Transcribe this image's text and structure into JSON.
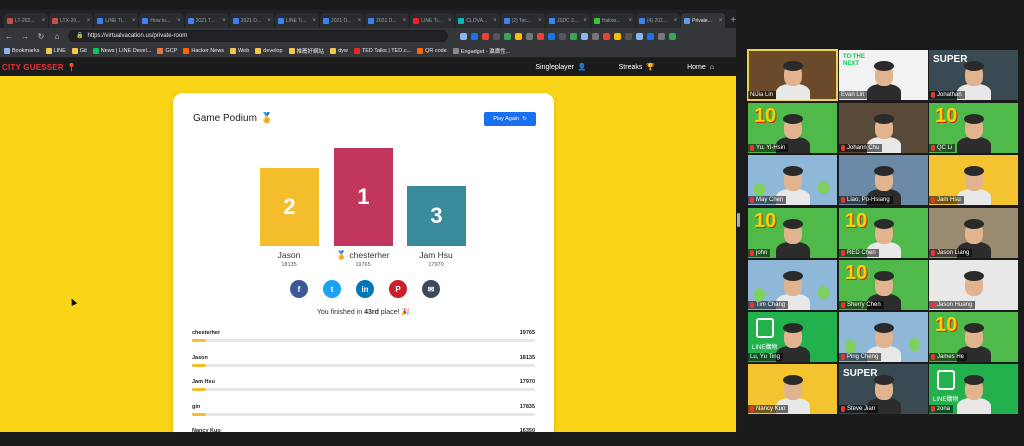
{
  "browser": {
    "tabs": [
      {
        "label": "LT-202...",
        "color": "#c94d4d"
      },
      {
        "label": "LTX-20...",
        "color": "#c94d4d"
      },
      {
        "label": "LINE Ti...",
        "color": "#3b82f6"
      },
      {
        "label": "How to...",
        "color": "#3b82f6"
      },
      {
        "label": "2021 T...",
        "color": "#3b82f6"
      },
      {
        "label": "2021 D...",
        "color": "#3b82f6"
      },
      {
        "label": "LINE Ti...",
        "color": "#3b82f6"
      },
      {
        "label": "2021 D...",
        "color": "#3b82f6"
      },
      {
        "label": "2021 D...",
        "color": "#3b82f6"
      },
      {
        "label": "LINE Ti...",
        "color": "#e22"
      },
      {
        "label": "CLOVA...",
        "color": "#0bb"
      },
      {
        "label": "(2) Tec...",
        "color": "#3b82f6"
      },
      {
        "label": "JSDC 2...",
        "color": "#3b82f6"
      },
      {
        "label": "Hakoo...",
        "color": "#3c3"
      },
      {
        "label": "(4) 202...",
        "color": "#3b82f6"
      },
      {
        "label": "Private...",
        "color": "#5aa0e8",
        "active": true
      }
    ],
    "new_tab": "+",
    "url_scheme": "https://",
    "url": "virtualvacation.us/private-room",
    "bookmarks": [
      {
        "label": "Bookmarks",
        "color": "#8ab4f8"
      },
      {
        "label": "LINE",
        "color": "#f1c84b"
      },
      {
        "label": "Git",
        "color": "#f1c84b"
      },
      {
        "label": "News | LINE Devel...",
        "color": "#06c755"
      },
      {
        "label": "GCP",
        "color": "#e8743b"
      },
      {
        "label": "Hacker News",
        "color": "#f60"
      },
      {
        "label": "Web",
        "color": "#f1c84b"
      },
      {
        "label": "develop",
        "color": "#f1c84b"
      },
      {
        "label": "推薦好網站",
        "color": "#f1c84b"
      },
      {
        "label": "dyw",
        "color": "#f1c84b"
      },
      {
        "label": "TED Talks | TED.c...",
        "color": "#e62b1e"
      },
      {
        "label": "QR code",
        "color": "#f60"
      },
      {
        "label": "Engadget - 瀛膺性...",
        "color": "#888"
      }
    ]
  },
  "site": {
    "logo": "CITY GUESSER",
    "nav": {
      "singleplayer": "Singleplayer",
      "streaks": "Streaks",
      "home": "Home"
    },
    "card": {
      "title": "Game Podium",
      "play_again": "Play Again",
      "podium": [
        {
          "rank": "2",
          "name": "Jason",
          "score": "18135"
        },
        {
          "rank": "1",
          "name": "chesterher",
          "score": "19765",
          "medal": "🏅"
        },
        {
          "rank": "3",
          "name": "Jam Hsu",
          "score": "17970"
        }
      ],
      "share": [
        {
          "name": "facebook",
          "glyph": "f",
          "color": "#3b5998"
        },
        {
          "name": "twitter",
          "glyph": "t",
          "color": "#1da1f2"
        },
        {
          "name": "linkedin",
          "glyph": "in",
          "color": "#0077b5"
        },
        {
          "name": "pinterest",
          "glyph": "P",
          "color": "#cb2027"
        },
        {
          "name": "email",
          "glyph": "✉",
          "color": "#3c4a5a"
        }
      ],
      "finish_pre": "You finished in ",
      "finish_place": "43rd",
      "finish_post": " place! 🎉",
      "leaderboard": [
        {
          "name": "chesterher",
          "score": "19765"
        },
        {
          "name": "Jason",
          "score": "18135"
        },
        {
          "name": "Jam Hsu",
          "score": "17970"
        },
        {
          "name": "gin",
          "score": "17835"
        },
        {
          "name": "Nancy Kuo",
          "score": "16350"
        }
      ]
    }
  },
  "meeting": {
    "participants": [
      {
        "name": "NiJia Lin",
        "muted": false,
        "speaking": true,
        "bg": "#6b4a2c"
      },
      {
        "name": "Evan Lin",
        "muted": false,
        "bg": "#f2f2f2"
      },
      {
        "name": "Jonathan",
        "muted": true,
        "bg": "#3a4a52"
      },
      {
        "name": "Yu, Yi-Hsin",
        "muted": true,
        "bg": "#4fb94a"
      },
      {
        "name": "Johann Chu",
        "muted": true,
        "bg": "#5a4a3a"
      },
      {
        "name": "QC Li",
        "muted": true,
        "bg": "#4fb94a"
      },
      {
        "name": "May Chen",
        "muted": true,
        "bg": "#8fb8d8"
      },
      {
        "name": "Liao, Po-Hsiang",
        "muted": true,
        "bg": "#6a8aa8"
      },
      {
        "name": "Jam Hsu",
        "muted": true,
        "bg": "#f4c330"
      },
      {
        "name": "john",
        "muted": true,
        "bg": "#4fb94a"
      },
      {
        "name": "RED Chen",
        "muted": true,
        "bg": "#4fb94a"
      },
      {
        "name": "Jason Liang",
        "muted": true,
        "bg": "#9a8a70"
      },
      {
        "name": "Tim Chang",
        "muted": true,
        "bg": "#8fb8d8"
      },
      {
        "name": "Sherry Chen",
        "muted": true,
        "bg": "#4fb94a"
      },
      {
        "name": "Jason Huang",
        "muted": true,
        "bg": "#e8e8e8"
      },
      {
        "name": "Lu, Yu Ting",
        "muted": false,
        "bg": "#22b14c"
      },
      {
        "name": "Ping Cheng",
        "muted": true,
        "bg": "#8fb8d8"
      },
      {
        "name": "James He",
        "muted": true,
        "bg": "#4fb94a"
      },
      {
        "name": "Nancy Kuo",
        "muted": true,
        "bg": "#f4c330"
      },
      {
        "name": "Steve Jian",
        "muted": true,
        "bg": "#3a4a52"
      },
      {
        "name": "zona",
        "muted": true,
        "bg": "#22b14c"
      }
    ],
    "tile_text": {
      "to_the_next": "TO THE NEXT",
      "super": "SUPER",
      "ten": "10",
      "line_shop": "LINE購物"
    }
  }
}
